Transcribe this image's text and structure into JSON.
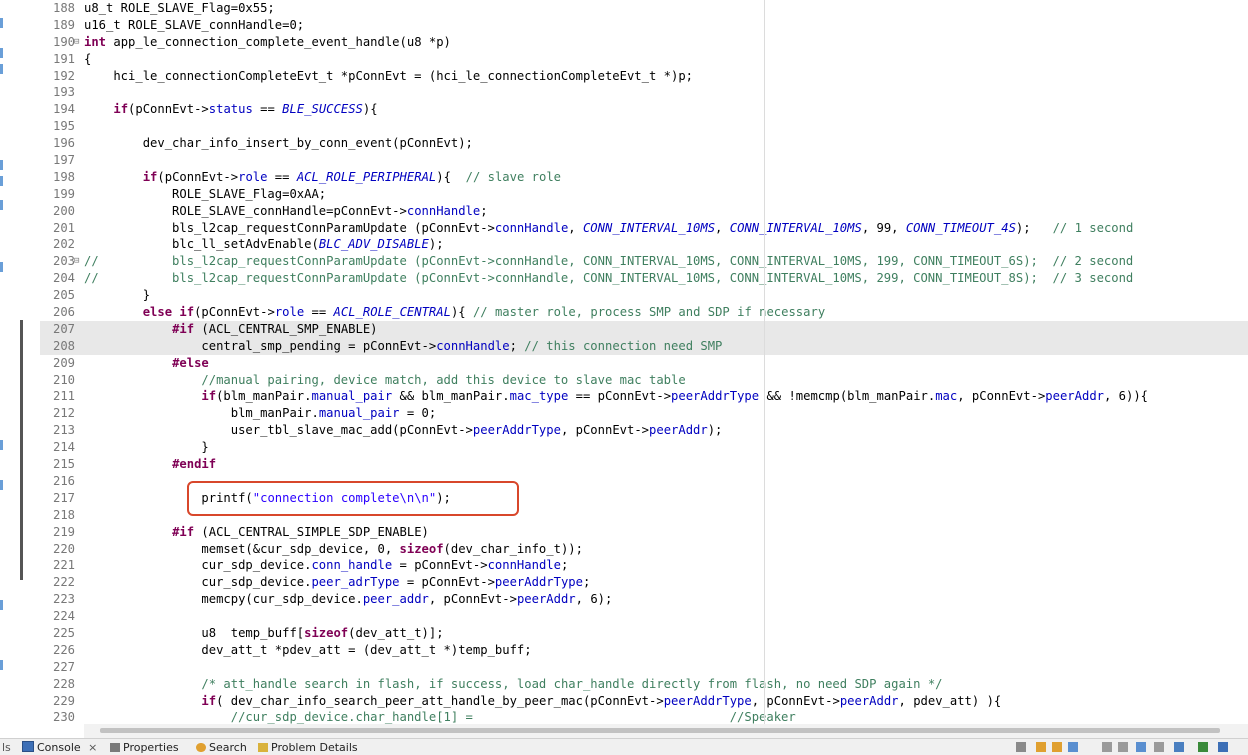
{
  "theme": {
    "keyword": "#7f0055",
    "field": "#0000c0",
    "string": "#2a00ff",
    "comment": "#3f7f5f",
    "highlight": "#e8e8e8",
    "callout": "#d8472b"
  },
  "lines": [
    {
      "n": "188",
      "t": "u8_t ROLE_SLAVE_Flag=0x55;"
    },
    {
      "n": "189",
      "t": "u16_t ROLE_SLAVE_connHandle=0;"
    },
    {
      "n": "190",
      "t": "int app_le_connection_complete_event_handle(u8 *p)",
      "fold": "⊟"
    },
    {
      "n": "191",
      "t": "{"
    },
    {
      "n": "192",
      "t": "    hci_le_connectionCompleteEvt_t *pConnEvt = (hci_le_connectionCompleteEvt_t *)p;"
    },
    {
      "n": "193",
      "t": ""
    },
    {
      "n": "194",
      "t": "    if(pConnEvt->status == BLE_SUCCESS){"
    },
    {
      "n": "195",
      "t": ""
    },
    {
      "n": "196",
      "t": "        dev_char_info_insert_by_conn_event(pConnEvt);"
    },
    {
      "n": "197",
      "t": ""
    },
    {
      "n": "198",
      "t": "        if(pConnEvt->role == ACL_ROLE_PERIPHERAL){  // slave role"
    },
    {
      "n": "199",
      "t": "            ROLE_SLAVE_Flag=0xAA;"
    },
    {
      "n": "200",
      "t": "            ROLE_SLAVE_connHandle=pConnEvt->connHandle;"
    },
    {
      "n": "201",
      "t": "            bls_l2cap_requestConnParamUpdate (pConnEvt->connHandle, CONN_INTERVAL_10MS, CONN_INTERVAL_10MS, 99, CONN_TIMEOUT_4S);   // 1 second"
    },
    {
      "n": "202",
      "t": "            blc_ll_setAdvEnable(BLC_ADV_DISABLE);"
    },
    {
      "n": "203",
      "t": "//          bls_l2cap_requestConnParamUpdate (pConnEvt->connHandle, CONN_INTERVAL_10MS, CONN_INTERVAL_10MS, 199, CONN_TIMEOUT_6S);  // 2 second",
      "fold": "⊟"
    },
    {
      "n": "204",
      "t": "//          bls_l2cap_requestConnParamUpdate (pConnEvt->connHandle, CONN_INTERVAL_10MS, CONN_INTERVAL_10MS, 299, CONN_TIMEOUT_8S);  // 3 second"
    },
    {
      "n": "205",
      "t": "        }"
    },
    {
      "n": "206",
      "t": "        else if(pConnEvt->role == ACL_ROLE_CENTRAL){ // master role, process SMP and SDP if necessary"
    },
    {
      "n": "207",
      "t": "            #if (ACL_CENTRAL_SMP_ENABLE)",
      "hl": true
    },
    {
      "n": "208",
      "t": "                central_smp_pending = pConnEvt->connHandle; // this connection need SMP",
      "hl": true
    },
    {
      "n": "209",
      "t": "            #else"
    },
    {
      "n": "210",
      "t": "                //manual pairing, device match, add this device to slave mac table"
    },
    {
      "n": "211",
      "t": "                if(blm_manPair.manual_pair && blm_manPair.mac_type == pConnEvt->peerAddrType && !memcmp(blm_manPair.mac, pConnEvt->peerAddr, 6)){"
    },
    {
      "n": "212",
      "t": "                    blm_manPair.manual_pair = 0;"
    },
    {
      "n": "213",
      "t": "                    user_tbl_slave_mac_add(pConnEvt->peerAddrType, pConnEvt->peerAddr);"
    },
    {
      "n": "214",
      "t": "                }"
    },
    {
      "n": "215",
      "t": "            #endif"
    },
    {
      "n": "216",
      "t": ""
    },
    {
      "n": "217",
      "t": "                printf(\"connection complete\\n\\n\");"
    },
    {
      "n": "218",
      "t": ""
    },
    {
      "n": "219",
      "t": "            #if (ACL_CENTRAL_SIMPLE_SDP_ENABLE)"
    },
    {
      "n": "220",
      "t": "                memset(&cur_sdp_device, 0, sizeof(dev_char_info_t));"
    },
    {
      "n": "221",
      "t": "                cur_sdp_device.conn_handle = pConnEvt->connHandle;"
    },
    {
      "n": "222",
      "t": "                cur_sdp_device.peer_adrType = pConnEvt->peerAddrType;"
    },
    {
      "n": "223",
      "t": "                memcpy(cur_sdp_device.peer_addr, pConnEvt->peerAddr, 6);"
    },
    {
      "n": "224",
      "t": ""
    },
    {
      "n": "225",
      "t": "                u8  temp_buff[sizeof(dev_att_t)];"
    },
    {
      "n": "226",
      "t": "                dev_att_t *pdev_att = (dev_att_t *)temp_buff;"
    },
    {
      "n": "227",
      "t": ""
    },
    {
      "n": "228",
      "t": "                /* att_handle search in flash, if success, load char_handle directly from flash, no need SDP again */"
    },
    {
      "n": "229",
      "t": "                if( dev_char_info_search_peer_att_handle_by_peer_mac(pConnEvt->peerAddrType, pConnEvt->peerAddr, pdev_att) ){"
    },
    {
      "n": "230",
      "t": "                    //cur_sdp_device.char_handle[1] =                                   //Speaker"
    }
  ],
  "bottom_tabs": [
    {
      "name": "console",
      "label": "Console",
      "close": "×"
    },
    {
      "name": "properties",
      "label": "Properties"
    },
    {
      "name": "search",
      "label": "Search"
    },
    {
      "name": "problem-details",
      "label": "Problem Details"
    }
  ],
  "bottom_left_stub": "ls"
}
